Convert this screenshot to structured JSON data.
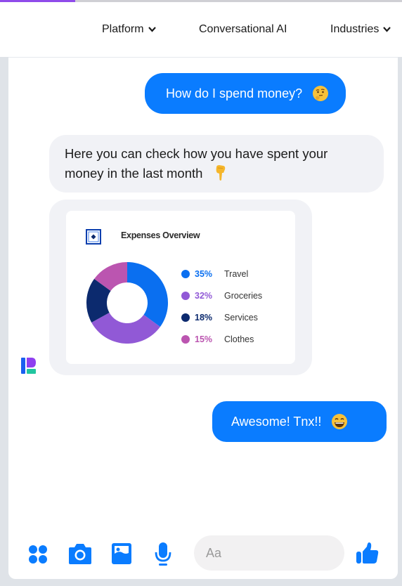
{
  "progress": {
    "percent": 18.7,
    "color": "#8f4bea"
  },
  "nav": {
    "items": [
      {
        "label": "Platform",
        "has_dropdown": true
      },
      {
        "label": "Conversational AI",
        "has_dropdown": false
      },
      {
        "label": "Industries",
        "has_dropdown": true
      }
    ]
  },
  "chat": {
    "messages": [
      {
        "sender": "user",
        "text": "How do I spend money?",
        "emoji": "thinking-face"
      },
      {
        "sender": "bot",
        "text": "Here you can check how you have spent your money in the last month",
        "emoji": "backhand-index-pointing-down"
      },
      {
        "sender": "bot",
        "type": "card"
      },
      {
        "sender": "user",
        "text": "Awesome! Tnx!!",
        "emoji": "grinning-face-with-smiling-eyes"
      }
    ],
    "colors": {
      "user_bubble": "#0a7cff",
      "bot_bubble": "#f1f2f6"
    }
  },
  "card": {
    "title": "Expenses Overview",
    "icon": "square-dot-icon"
  },
  "chart_data": {
    "type": "pie",
    "variant": "donut",
    "title": "Expenses Overview",
    "categories": [
      "Travel",
      "Groceries",
      "Services",
      "Clothes"
    ],
    "values": [
      35,
      32,
      18,
      15
    ],
    "value_labels": [
      "35%",
      "32%",
      "18%",
      "15%"
    ],
    "colors": [
      "#0a6ff0",
      "#9159d6",
      "#0c2a6e",
      "#bb55b0"
    ],
    "legend": "right",
    "start_angle": "top, clockwise"
  },
  "composer": {
    "placeholder": "Aa",
    "icons": [
      "apps-icon",
      "camera-icon",
      "image-icon",
      "microphone-icon",
      "thumbs-up-icon"
    ],
    "accent": "#0a7cff"
  }
}
